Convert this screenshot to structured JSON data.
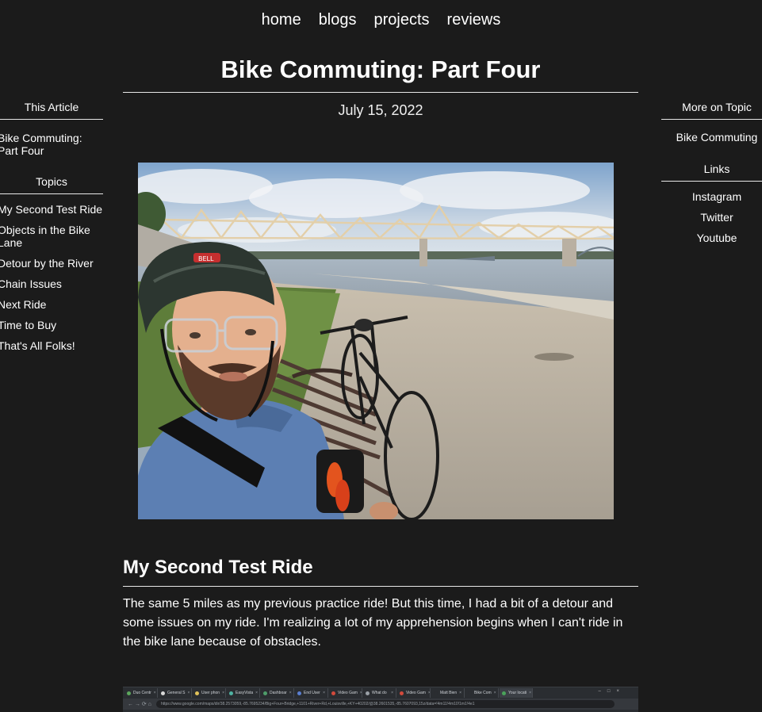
{
  "nav": {
    "items": [
      "home",
      "blogs",
      "projects",
      "reviews"
    ]
  },
  "article": {
    "title": "Bike Commuting: Part Four",
    "date": "July 15, 2022",
    "section_title": "My Second Test Ride",
    "paragraph": "The same 5 miles as my previous practice ride! But this time, I had a bit of a detour and some issues on my ride. I'm realizing a lot of my apprehension begins when I can't ride in the bike lane because of obstacles."
  },
  "left_sidebar": {
    "this_article_heading": "This Article",
    "this_article_link": "Bike Commuting: Part Four",
    "topics_heading": "Topics",
    "topics": [
      "My Second Test Ride",
      "Objects in the Bike Lane",
      "Detour by the River",
      "Chain Issues",
      "Next Ride",
      "Time to Buy",
      "That's All Folks!"
    ]
  },
  "right_sidebar": {
    "more_heading": "More on Topic",
    "more_link": "Bike Commuting",
    "links_heading": "Links",
    "links": [
      "Instagram",
      "Twitter",
      "Youtube"
    ]
  },
  "browser_screenshot": {
    "tabs": [
      "Duo Centr",
      "General S",
      "User phon",
      "EasyVista",
      "Dashboar",
      "End User",
      "Video Gam",
      "What do",
      "Video Gam",
      "Matt Bien",
      "Bike Com",
      "Your locati"
    ],
    "address": "https://www.google.com/maps/dir/38.2573059,-85.7695234/Big+Four+Bridge,+1101+River+Rd,+Louisville,+KY+40202/@38.2601535,-85.7607093,15z/data=!4m11!4m10!1m1!4e1"
  },
  "colors": {
    "background": "#1b1b1b",
    "text": "#ffffff",
    "rule": "#e8e8e8"
  }
}
